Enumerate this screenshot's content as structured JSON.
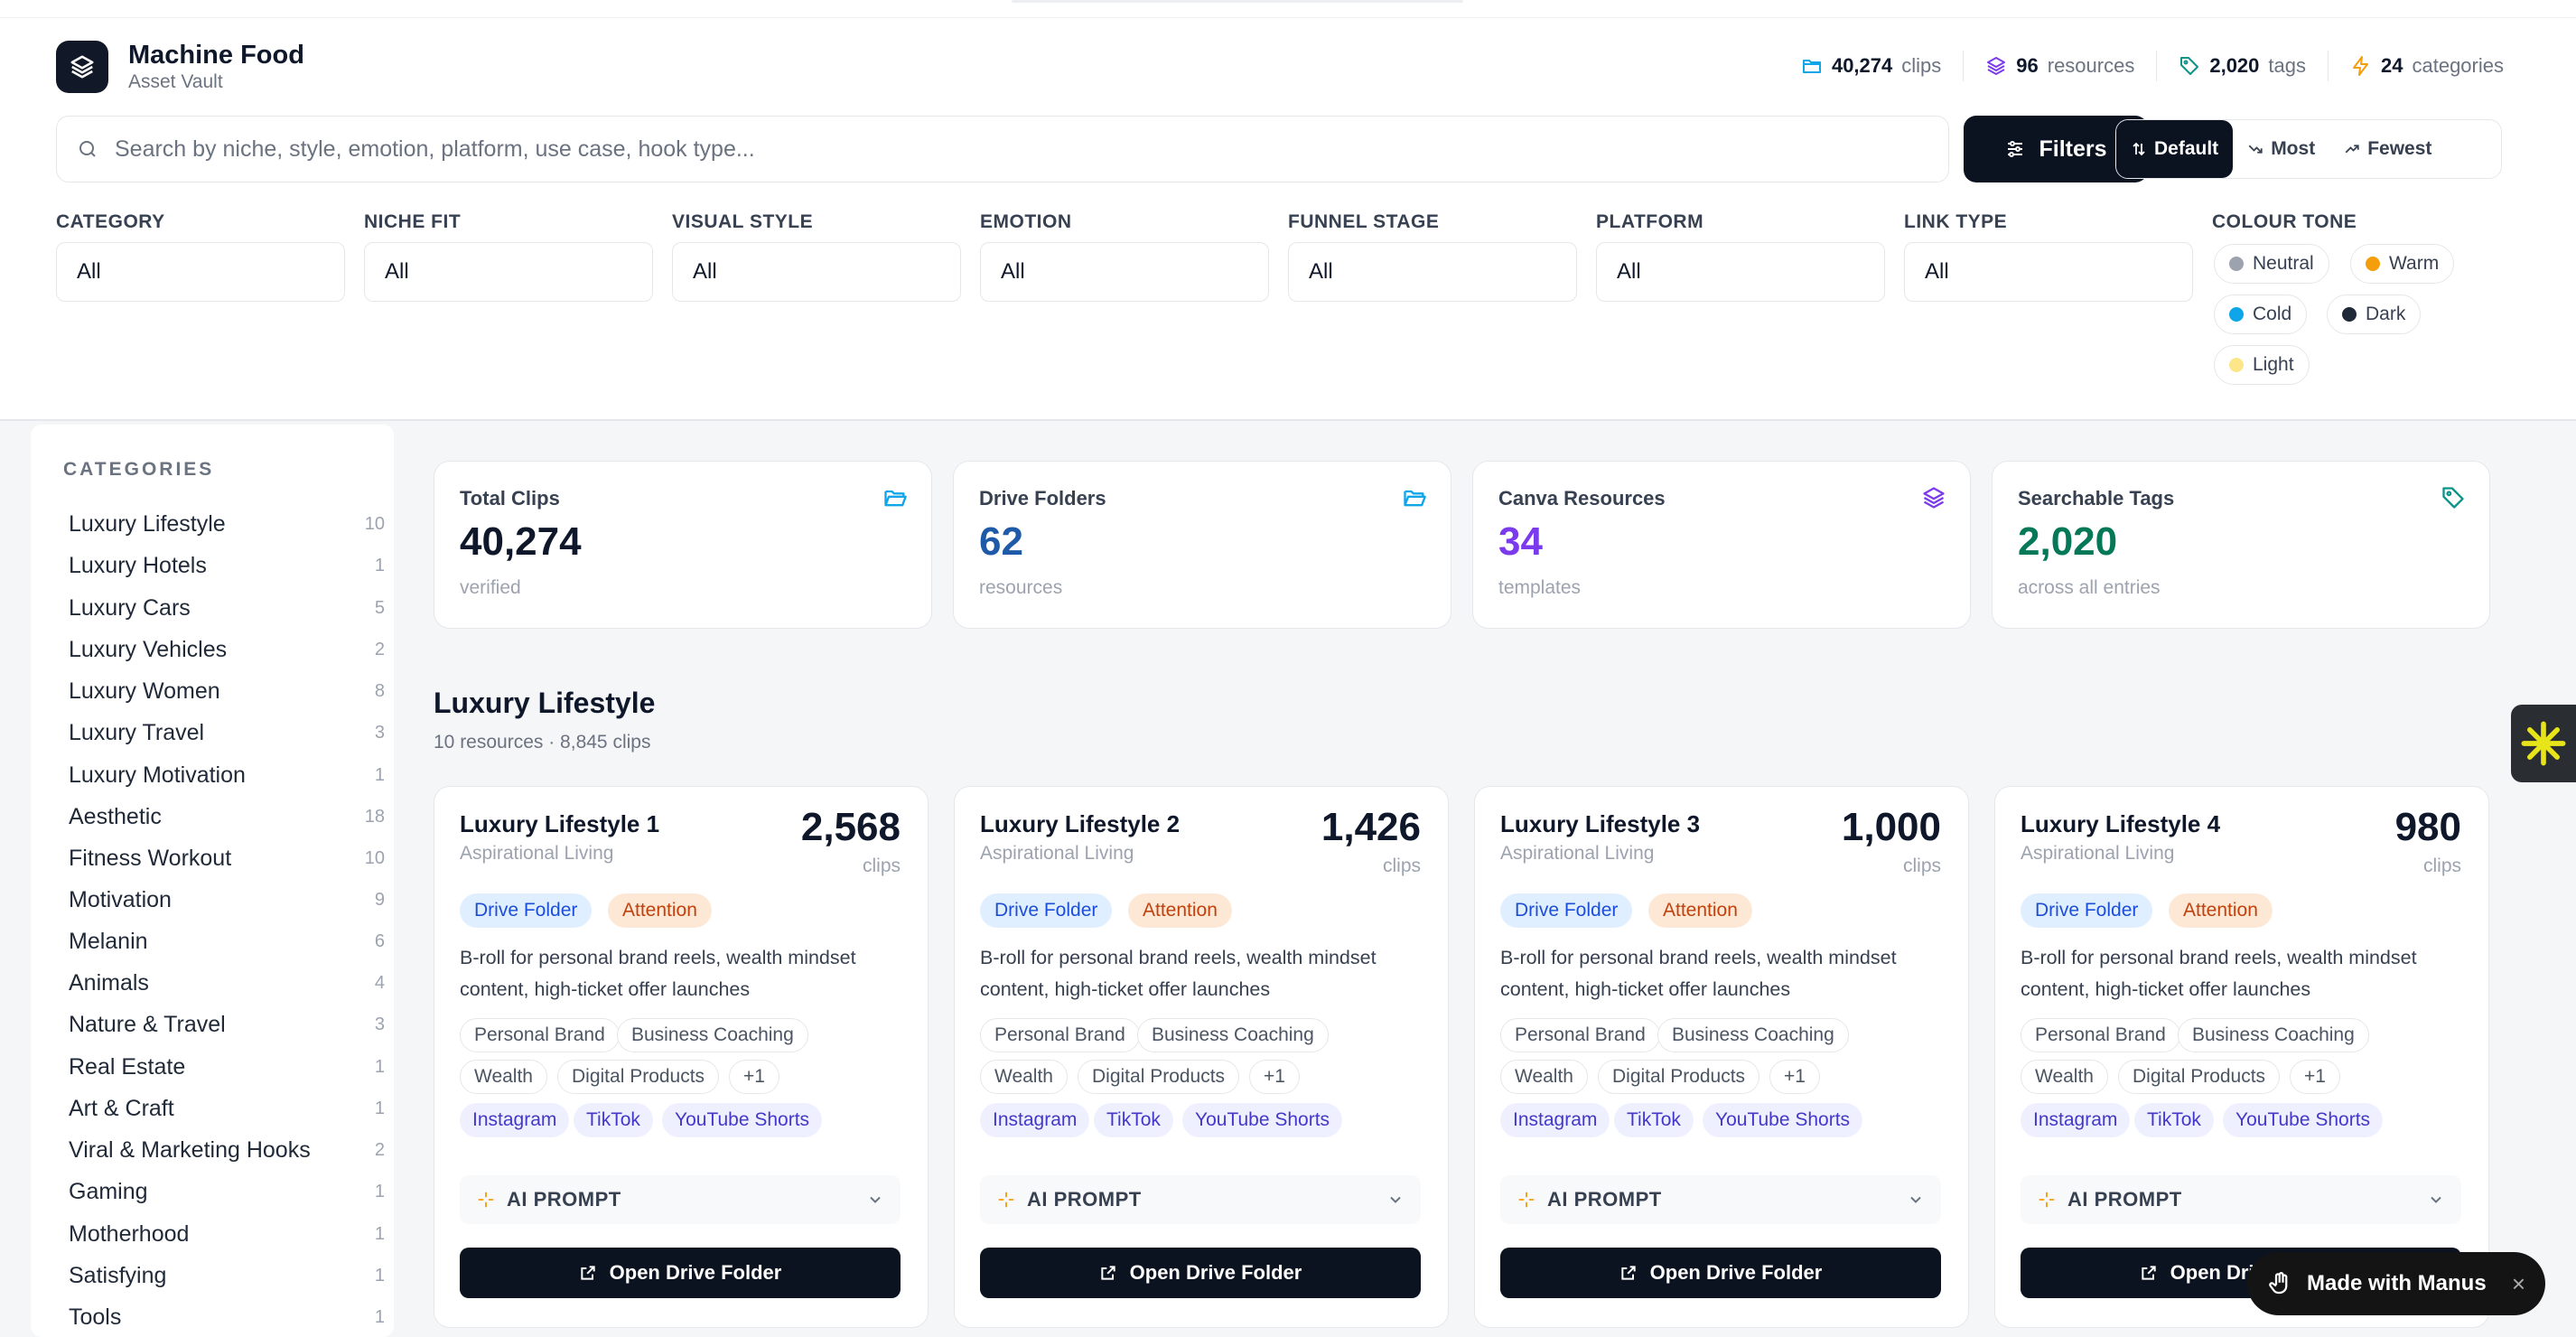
{
  "app": {
    "title": "Machine Food",
    "subtitle": "Asset Vault"
  },
  "header_stats": [
    {
      "value": "40,274",
      "label": "clips",
      "icon": "folder-icon",
      "color": "#0ea5e9"
    },
    {
      "value": "96",
      "label": "resources",
      "icon": "layers-icon",
      "color": "#7c3aed"
    },
    {
      "value": "2,020",
      "label": "tags",
      "icon": "tag-icon",
      "color": "#0d9488"
    },
    {
      "value": "24",
      "label": "categories",
      "icon": "bolt-icon",
      "color": "#f59e0b"
    }
  ],
  "search": {
    "placeholder": "Search by niche, style, emotion, platform, use case, hook type..."
  },
  "filters_button": "Filters",
  "sort": {
    "default": "Default",
    "most": "Most",
    "fewest": "Fewest"
  },
  "filters": [
    {
      "label": "CATEGORY",
      "value": "All"
    },
    {
      "label": "NICHE FIT",
      "value": "All"
    },
    {
      "label": "VISUAL STYLE",
      "value": "All"
    },
    {
      "label": "EMOTION",
      "value": "All"
    },
    {
      "label": "FUNNEL STAGE",
      "value": "All"
    },
    {
      "label": "PLATFORM",
      "value": "All"
    },
    {
      "label": "LINK TYPE",
      "value": "All"
    }
  ],
  "colour_tone": {
    "label": "COLOUR TONE",
    "options": [
      {
        "name": "Neutral",
        "color": "#9ca3af"
      },
      {
        "name": "Warm",
        "color": "#f59e0b"
      },
      {
        "name": "Cold",
        "color": "#0ea5e9"
      },
      {
        "name": "Dark",
        "color": "#1f2937"
      },
      {
        "name": "Light",
        "color": "#fde68a"
      }
    ]
  },
  "sidebar": {
    "title": "CATEGORIES",
    "items": [
      {
        "name": "Luxury Lifestyle",
        "count": "10"
      },
      {
        "name": "Luxury Hotels",
        "count": "1"
      },
      {
        "name": "Luxury Cars",
        "count": "5"
      },
      {
        "name": "Luxury Vehicles",
        "count": "2"
      },
      {
        "name": "Luxury Women",
        "count": "8"
      },
      {
        "name": "Luxury Travel",
        "count": "3"
      },
      {
        "name": "Luxury Motivation",
        "count": "1"
      },
      {
        "name": "Aesthetic",
        "count": "18"
      },
      {
        "name": "Fitness Workout",
        "count": "10"
      },
      {
        "name": "Motivation",
        "count": "9"
      },
      {
        "name": "Melanin",
        "count": "6"
      },
      {
        "name": "Animals",
        "count": "4"
      },
      {
        "name": "Nature & Travel",
        "count": "3"
      },
      {
        "name": "Real Estate",
        "count": "1"
      },
      {
        "name": "Art & Craft",
        "count": "1"
      },
      {
        "name": "Viral & Marketing Hooks",
        "count": "2"
      },
      {
        "name": "Gaming",
        "count": "1"
      },
      {
        "name": "Motherhood",
        "count": "1"
      },
      {
        "name": "Satisfying",
        "count": "1"
      },
      {
        "name": "Tools",
        "count": "1"
      }
    ]
  },
  "summary_cards": [
    {
      "label": "Total Clips",
      "value": "40,274",
      "sub": "verified",
      "color": "#0f172a",
      "icon": "folder-open-icon",
      "icon_color": "#0ea5e9"
    },
    {
      "label": "Drive Folders",
      "value": "62",
      "sub": "resources",
      "color": "#1e5aa8",
      "icon": "folder-open-icon",
      "icon_color": "#0ea5e9"
    },
    {
      "label": "Canva Resources",
      "value": "34",
      "sub": "templates",
      "color": "#7c3aed",
      "icon": "layers-icon",
      "icon_color": "#7c3aed"
    },
    {
      "label": "Searchable Tags",
      "value": "2,020",
      "sub": "across all entries",
      "color": "#047857",
      "icon": "tag-icon",
      "icon_color": "#0d9488"
    }
  ],
  "section": {
    "title": "Luxury Lifestyle",
    "subtitle": "10 resources · 8,845 clips"
  },
  "resources": [
    {
      "name": "Luxury Lifestyle 1",
      "subtitle": "Aspirational Living",
      "clips": "2,568",
      "clips_label": "clips",
      "badges": [
        "Drive Folder",
        "Attention"
      ],
      "description": "B-roll for personal brand reels, wealth mindset content, high-ticket offer launches",
      "tags": [
        "Personal Brand",
        "Business Coaching",
        "Wealth",
        "Digital Products",
        "+1"
      ],
      "platforms": [
        "Instagram",
        "TikTok",
        "YouTube Shorts"
      ],
      "prompt_label": "AI PROMPT",
      "button": "Open Drive Folder"
    },
    {
      "name": "Luxury Lifestyle 2",
      "subtitle": "Aspirational Living",
      "clips": "1,426",
      "clips_label": "clips",
      "badges": [
        "Drive Folder",
        "Attention"
      ],
      "description": "B-roll for personal brand reels, wealth mindset content, high-ticket offer launches",
      "tags": [
        "Personal Brand",
        "Business Coaching",
        "Wealth",
        "Digital Products",
        "+1"
      ],
      "platforms": [
        "Instagram",
        "TikTok",
        "YouTube Shorts"
      ],
      "prompt_label": "AI PROMPT",
      "button": "Open Drive Folder"
    },
    {
      "name": "Luxury Lifestyle 3",
      "subtitle": "Aspirational Living",
      "clips": "1,000",
      "clips_label": "clips",
      "badges": [
        "Drive Folder",
        "Attention"
      ],
      "description": "B-roll for personal brand reels, wealth mindset content, high-ticket offer launches",
      "tags": [
        "Personal Brand",
        "Business Coaching",
        "Wealth",
        "Digital Products",
        "+1"
      ],
      "platforms": [
        "Instagram",
        "TikTok",
        "YouTube Shorts"
      ],
      "prompt_label": "AI PROMPT",
      "button": "Open Drive Folder"
    },
    {
      "name": "Luxury Lifestyle 4",
      "subtitle": "Aspirational Living",
      "clips": "980",
      "clips_label": "clips",
      "badges": [
        "Drive Folder",
        "Attention"
      ],
      "description": "B-roll for personal brand reels, wealth mindset content, high-ticket offer launches",
      "tags": [
        "Personal Brand",
        "Business Coaching",
        "Wealth",
        "Digital Products",
        "+1"
      ],
      "platforms": [
        "Instagram",
        "TikTok",
        "YouTube Shorts"
      ],
      "prompt_label": "AI PROMPT",
      "button": "Open Drive Folder"
    }
  ],
  "manus_badge": {
    "label": "Made with Manus",
    "close": "×"
  }
}
